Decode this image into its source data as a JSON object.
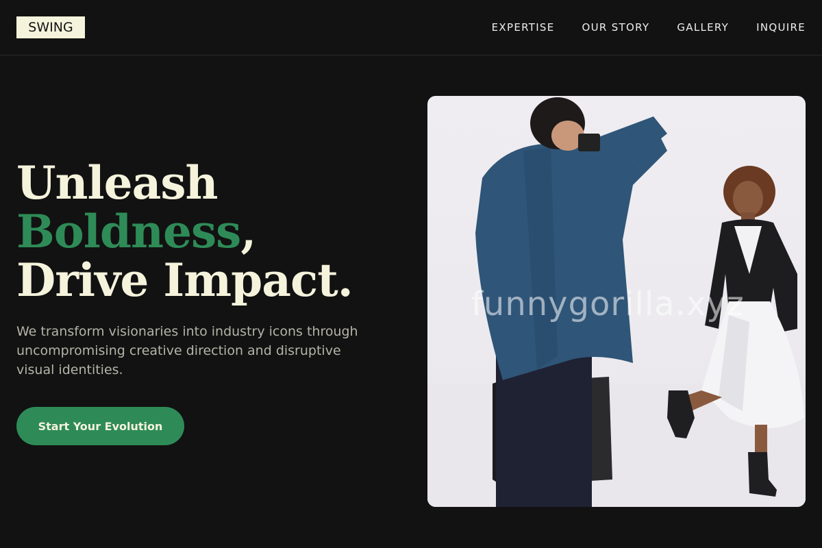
{
  "brand": {
    "logo_text": "SWING"
  },
  "nav": {
    "items": [
      {
        "label": "EXPERTISE"
      },
      {
        "label": "OUR STORY"
      },
      {
        "label": "GALLERY"
      },
      {
        "label": "INQUIRE"
      }
    ]
  },
  "hero": {
    "headline_line1": "Unleash",
    "headline_accent": "Boldness",
    "headline_comma": ",",
    "headline_line3": "Drive Impact.",
    "description": "We transform visionaries into industry icons through uncompromising creative direction and disruptive visual identities.",
    "cta_label": "Start Your Evolution",
    "image_watermark": "funnygorilla.xyz"
  },
  "colors": {
    "background": "#121212",
    "logo_bg": "#f5f3dc",
    "headline": "#f5f3dc",
    "accent": "#2e8b57",
    "body_text": "#b4b4a8"
  }
}
